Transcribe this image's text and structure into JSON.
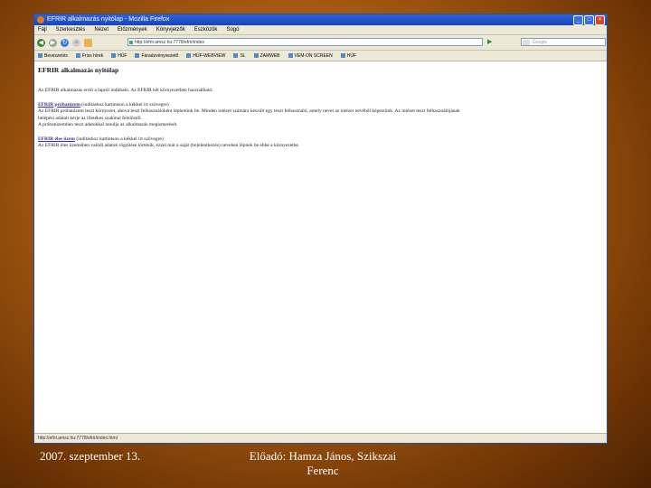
{
  "window": {
    "title": "EFRIR alkalmazás nyitólap - Mozilla Firefox"
  },
  "menu": [
    "Fájl",
    "Szerkesztés",
    "Nézet",
    "Előzmények",
    "Könyvjelzők",
    "Eszközök",
    "Súgó"
  ],
  "nav": {
    "url": "http://efrir.amsz.hu:7778/efrir/index"
  },
  "search": {
    "placeholder": "Google"
  },
  "bookmarks": [
    "Beveszetés",
    "Friss hírek",
    "HÚF",
    "Fáradzvényvezető",
    "HÚF-WEBVIEW",
    "SL",
    "ZAMWEB",
    "VEM-ON SCREEN",
    "HÚF"
  ],
  "page": {
    "heading": "EFRIR alkalmazás nyitólap",
    "intro": "Az EFRIR alkalmazás erről a lapról indítható. Az EFRIR két környezetben használható:",
    "link1": "EFRIR próbatúzem",
    "link1_suffix": " (indításhoz kattintson a kékkel írt szövegre)",
    "p1a": "Az EFRIR próbatúzem teszt környezet, ahova teszt felhasználóként léphetünk be. Minden intézet számára készült egy teszt felhasználó, amely nevet az intézet nevéből képeztünk. Az intézet teszt felhasználójának",
    "p1b": "belépési adatait kérje az illetékes szakmai felelőstől.",
    "p1c": "A próbatúzemben teszt adatokkal tanulja az alkalmazás megismerését.",
    "link2": "EFRIR éles üzem",
    "link2_suffix": " (indításhoz kattintson a kékkel írt szövegre)",
    "p2": "Az EFRIR éles üzemében valódi adatok rögzítése történik, ezzel már a saját (bejelentkezés) neveken lépnek be ebbe a környezetbe."
  },
  "status": {
    "text": "http://efrir.amsz.hu:7778/efrir/index.html"
  },
  "footer": {
    "date": "2007. szeptember 13.",
    "author": "Előadó: Hamza János, Szikszai Ferenc"
  }
}
